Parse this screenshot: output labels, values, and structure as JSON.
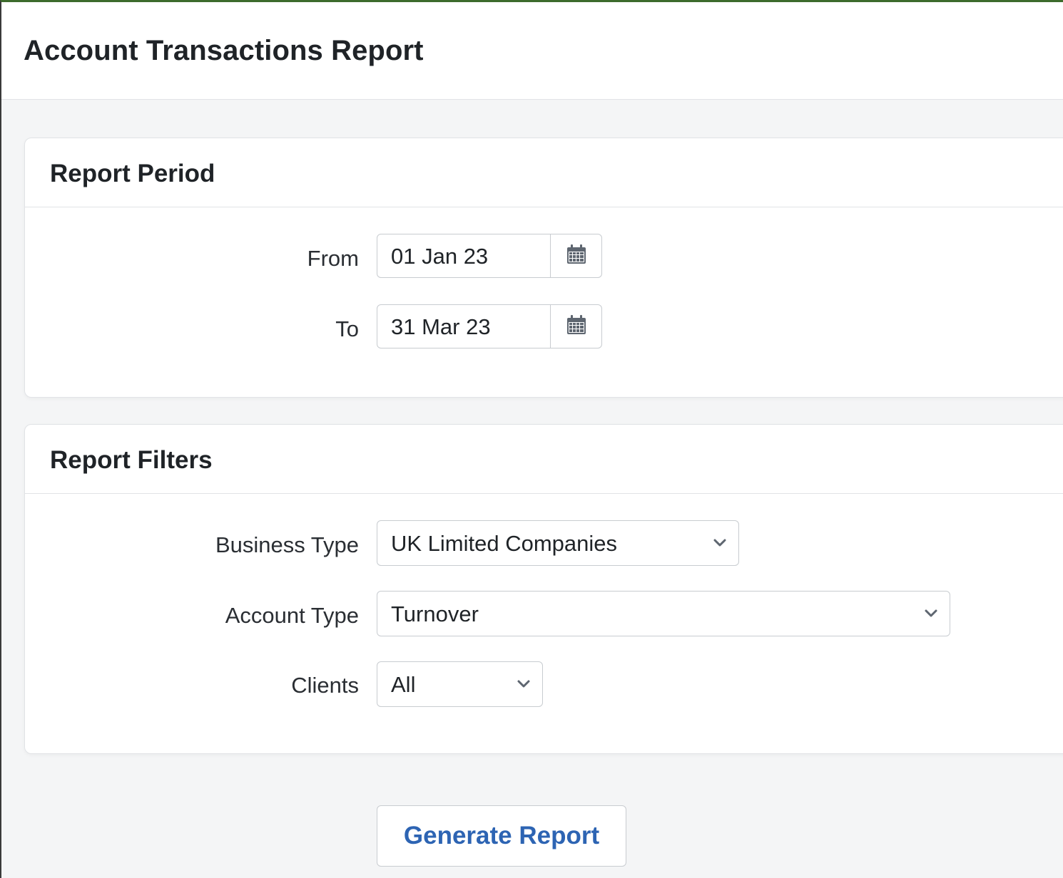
{
  "page": {
    "title": "Account Transactions Report"
  },
  "report_period": {
    "title": "Report Period",
    "from_label": "From",
    "from_value": "01 Jan 23",
    "from_icon": "calendar-icon",
    "to_label": "To",
    "to_value": "31 Mar 23",
    "to_icon": "calendar-icon"
  },
  "report_filters": {
    "title": "Report Filters",
    "business_type_label": "Business Type",
    "business_type_value": "UK Limited Companies",
    "account_type_label": "Account Type",
    "account_type_value": "Turnover",
    "clients_label": "Clients",
    "clients_value": "All",
    "dropdown_icon": "chevron-down-icon"
  },
  "actions": {
    "generate_label": "Generate Report"
  },
  "colors": {
    "accent": "#2d64b3",
    "top_border": "#3d6b2c",
    "background": "#f4f5f6"
  }
}
